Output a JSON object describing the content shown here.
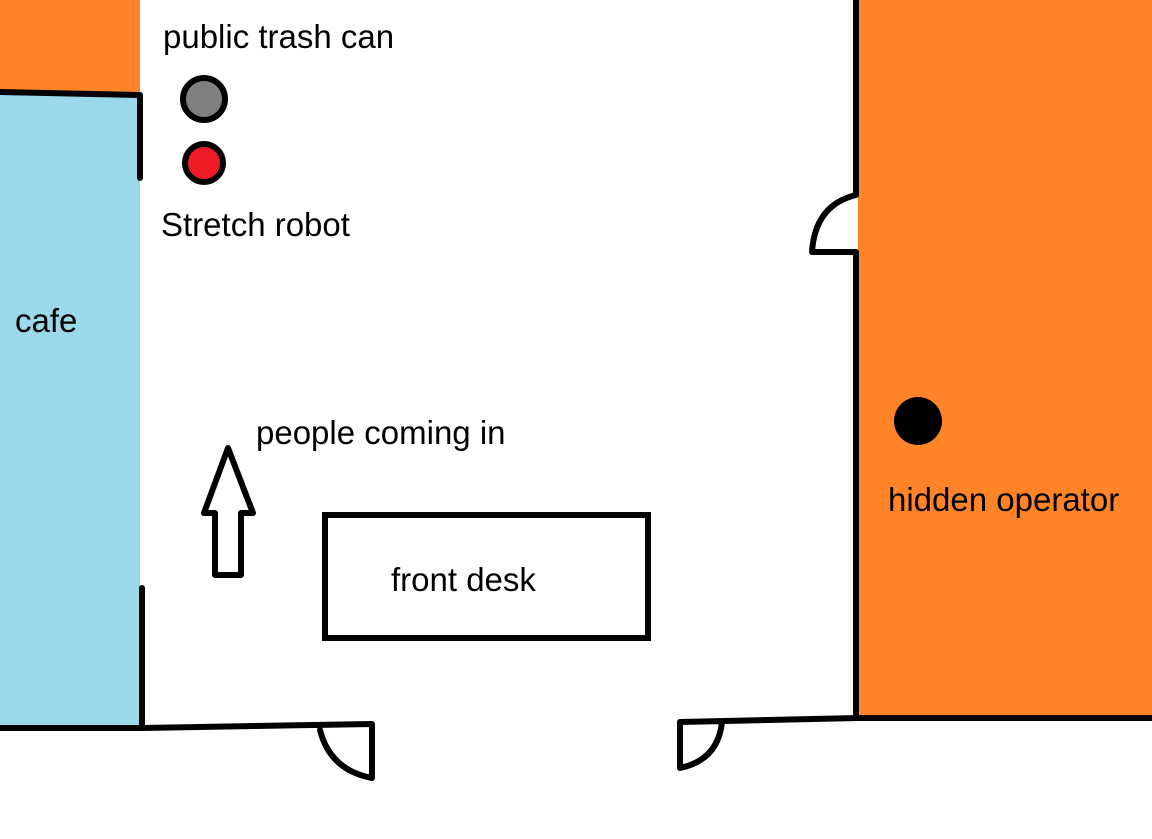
{
  "labels": {
    "trash_can": "public trash can",
    "robot": "Stretch robot",
    "cafe": "cafe",
    "people": "people coming in",
    "front_desk": "front desk",
    "operator": "hidden operator"
  },
  "colors": {
    "orange_area": "#FF8427",
    "cafe_area": "#99D9EA",
    "trash_can": "#7F7F7F",
    "robot": "#ED1C24",
    "operator": "#000000",
    "wall": "#000000",
    "floor": "#FFFFFF"
  },
  "markers": {
    "trash_can_icon": "filled-circle-grey",
    "robot_icon": "filled-circle-red",
    "operator_icon": "filled-circle-black",
    "direction_icon": "up-arrow-outline"
  }
}
